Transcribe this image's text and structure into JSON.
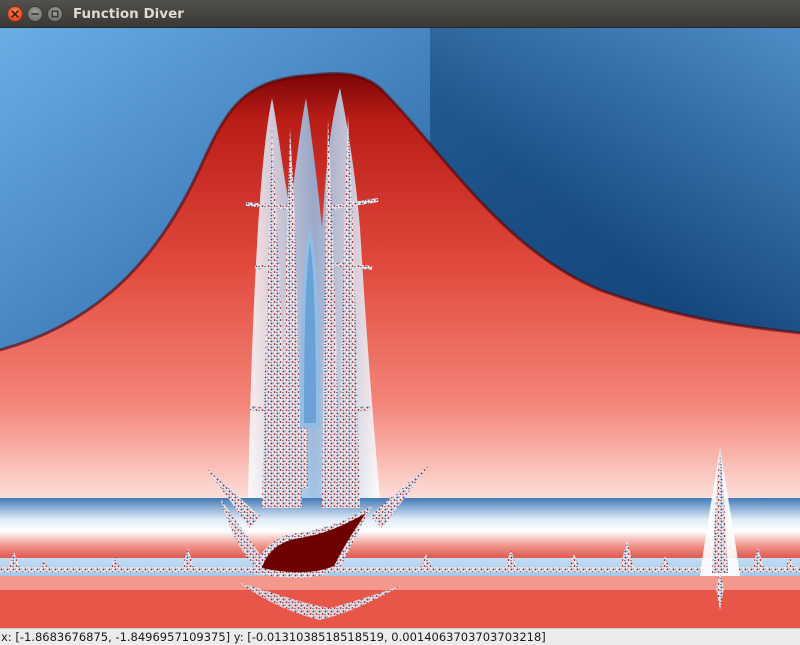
{
  "window": {
    "title": "Function Diver",
    "buttons": {
      "close_icon": "close-icon",
      "minimize_icon": "minimize-icon",
      "maximize_icon": "maximize-icon"
    }
  },
  "viewport": {
    "coloring": {
      "outer": "#0a3a6e",
      "mid_blue": "#5b9fd8",
      "light": "#ffffff",
      "red": "#e0463c",
      "dark_red": "#6e0000"
    }
  },
  "status": {
    "text": "x: [-1.8683676875, -1.8496957109375] y: [-0.0131038518518519, 0.0014063703703703218]"
  }
}
